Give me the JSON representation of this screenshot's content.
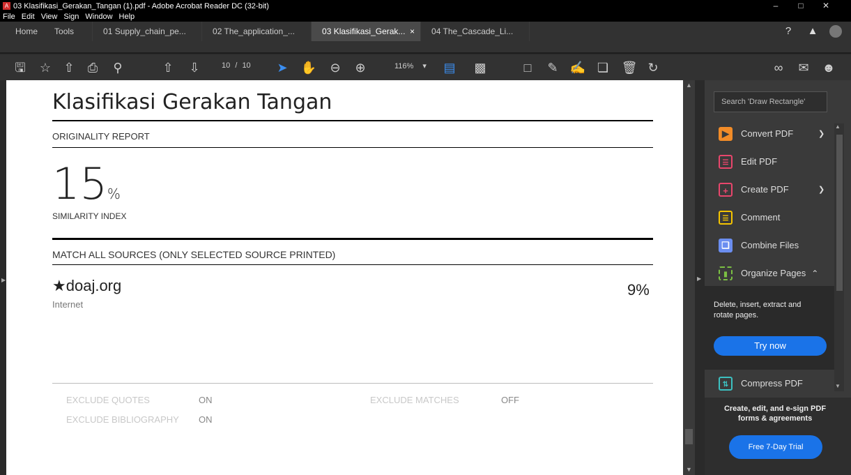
{
  "window": {
    "title": "03 Klasifikasi_Gerakan_Tangan (1).pdf - Adobe Acrobat Reader DC (32-bit)",
    "controls": [
      "–",
      "□",
      "✕"
    ]
  },
  "menu": [
    "File",
    "Edit",
    "View",
    "Sign",
    "Window",
    "Help"
  ],
  "tabs": {
    "home": "Home",
    "tools": "Tools",
    "docs": [
      "01 Supply_chain_pe...",
      "02 The_application_...",
      "03 Klasifikasi_Gerak...",
      "04 The_Cascade_Li..."
    ],
    "active_index": 2,
    "close": "×"
  },
  "toolbar": {
    "page_current": "10",
    "page_sep": "/",
    "page_total": "10",
    "zoom": "116%"
  },
  "document": {
    "title": "Klasifikasi Gerakan Tangan",
    "originality": "ORIGINALITY REPORT",
    "similarity_value": "15",
    "similarity_unit": "%",
    "similarity_label": "SIMILARITY INDEX",
    "match_heading": "MATCH ALL SOURCES (ONLY SELECTED SOURCE PRINTED)",
    "source": {
      "star": "★",
      "name": "doaj.org",
      "type": "Internet",
      "percent": "9%"
    },
    "exclude": {
      "quotes_label": "EXCLUDE QUOTES",
      "quotes_value": "ON",
      "bib_label": "EXCLUDE BIBLIOGRAPHY",
      "bib_value": "ON",
      "matches_label": "EXCLUDE MATCHES",
      "matches_value": "OFF"
    }
  },
  "panel": {
    "search_placeholder": "Search 'Draw Rectangle'",
    "tools": [
      {
        "label": "Convert PDF",
        "icon": "convert-pdf-icon",
        "color": "#f28c28"
      },
      {
        "label": "Edit PDF",
        "icon": "edit-pdf-icon",
        "color": "#e8466c"
      },
      {
        "label": "Create PDF",
        "icon": "create-pdf-icon",
        "color": "#e8466c"
      },
      {
        "label": "Comment",
        "icon": "comment-icon",
        "color": "#f5c400"
      },
      {
        "label": "Combine Files",
        "icon": "combine-files-icon",
        "color": "#6b8ef0"
      },
      {
        "label": "Organize Pages",
        "icon": "organize-pages-icon",
        "color": "#7bc043"
      },
      {
        "label": "Compress PDF",
        "icon": "compress-pdf-icon",
        "color": "#3cc0c0"
      }
    ],
    "organize_desc": "Delete, insert, extract and rotate pages.",
    "try_now": "Try now",
    "promo_text": "Create, edit, and e-sign PDF forms & agreements",
    "trial_button": "Free 7-Day Trial"
  }
}
